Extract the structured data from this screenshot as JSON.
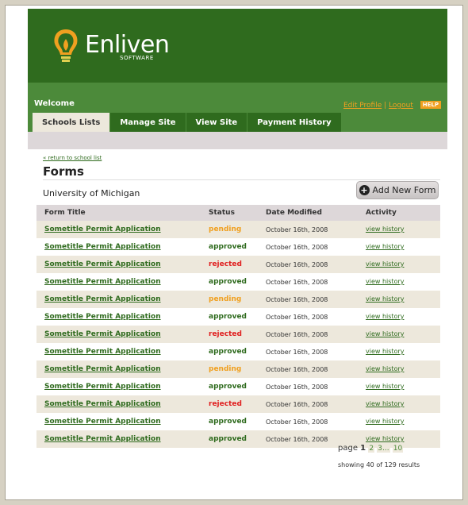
{
  "brand": {
    "name": "Enliven",
    "sub": "SOFTWARE",
    "colors": {
      "dark_green": "#2f6b1e",
      "mid_green": "#4c8a3a",
      "orange": "#f0a020",
      "row_alt": "#ede8dc"
    }
  },
  "nav": {
    "welcome": "Welcome",
    "edit_profile": "Edit Profile",
    "separator": "|",
    "logout": "Logout",
    "help": "HELP",
    "tabs": [
      {
        "label": "Schools Lists",
        "active": true
      },
      {
        "label": "Manage Site",
        "active": false
      },
      {
        "label": "View Site",
        "active": false
      },
      {
        "label": "Payment History",
        "active": false
      }
    ]
  },
  "main": {
    "return_link": "« return to school list",
    "title": "Forms",
    "school": "University of Michigan",
    "add_button": "Add New Form",
    "add_icon": "plus-circle-icon"
  },
  "table": {
    "headers": {
      "title": "Form Title",
      "status": "Status",
      "date": "Date Modified",
      "activity": "Activity"
    },
    "rows": [
      {
        "title": "Sometitle Permit Application",
        "status": "pending",
        "date": "October 16th, 2008",
        "activity": "view history"
      },
      {
        "title": "Sometitle Permit Application",
        "status": "approved",
        "date": "October 16th, 2008",
        "activity": "view history"
      },
      {
        "title": "Sometitle Permit Application",
        "status": "rejected",
        "date": "October 16th, 2008",
        "activity": "view history"
      },
      {
        "title": "Sometitle Permit Application",
        "status": "approved",
        "date": "October 16th, 2008",
        "activity": "view history"
      },
      {
        "title": "Sometitle Permit Application",
        "status": "pending",
        "date": "October 16th, 2008",
        "activity": "view history"
      },
      {
        "title": "Sometitle Permit Application",
        "status": "approved",
        "date": "October 16th, 2008",
        "activity": "view history"
      },
      {
        "title": "Sometitle Permit Application",
        "status": "rejected",
        "date": "October 16th, 2008",
        "activity": "view history"
      },
      {
        "title": "Sometitle Permit Application",
        "status": "approved",
        "date": "October 16th, 2008",
        "activity": "view history"
      },
      {
        "title": "Sometitle Permit Application",
        "status": "pending",
        "date": "October 16th, 2008",
        "activity": "view history"
      },
      {
        "title": "Sometitle Permit Application",
        "status": "approved",
        "date": "October 16th, 2008",
        "activity": "view history"
      },
      {
        "title": "Sometitle Permit Application",
        "status": "rejected",
        "date": "October 16th, 2008",
        "activity": "view history"
      },
      {
        "title": "Sometitle Permit Application",
        "status": "approved",
        "date": "October 16th, 2008",
        "activity": "view history"
      },
      {
        "title": "Sometitle Permit Application",
        "status": "approved",
        "date": "October 16th, 2008",
        "activity": "view history"
      }
    ],
    "status_colors": {
      "pending": "#f0a020",
      "approved": "#2f6b1e",
      "rejected": "#e02020"
    }
  },
  "pagination": {
    "label": "page",
    "current": "1",
    "pages": [
      "2",
      "3..."
    ],
    "last": "10",
    "results": "showing 40 of 129 results"
  }
}
